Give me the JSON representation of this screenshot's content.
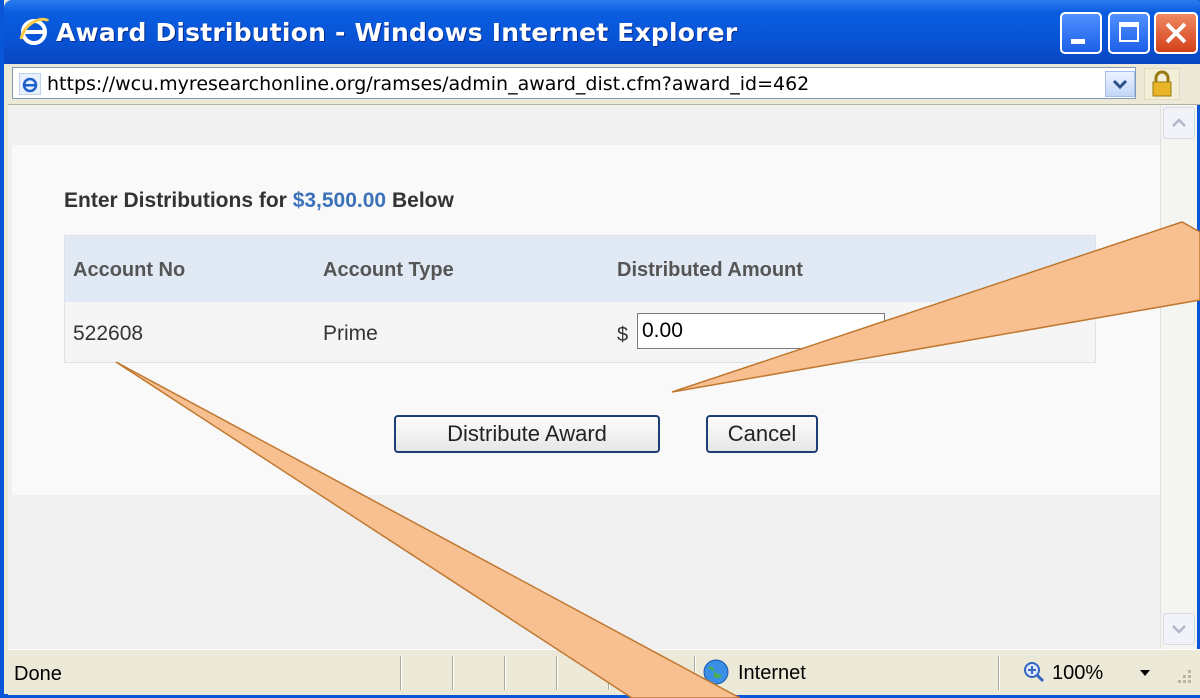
{
  "window": {
    "title": "Award Distribution - Windows Internet Explorer"
  },
  "address": {
    "url": "https://wcu.myresearchonline.org/ramses/admin_award_dist.cfm?award_id=462"
  },
  "page": {
    "heading_prefix": "Enter Distributions for",
    "heading_amount": "$3,500.00",
    "heading_suffix": "Below",
    "columns": [
      "Account No",
      "Account Type",
      "Distributed Amount"
    ],
    "row": {
      "account_no": "522608",
      "account_type": "Prime",
      "currency": "$",
      "amount": "0.00"
    },
    "buttons": {
      "distribute": "Distribute Award",
      "cancel": "Cancel"
    }
  },
  "status": {
    "text": "Done",
    "zone": "Internet",
    "zoom": "100%"
  },
  "colors": {
    "accent": "#3b72b9",
    "callout": "#f8c090",
    "title_bar": "#0854d6"
  }
}
